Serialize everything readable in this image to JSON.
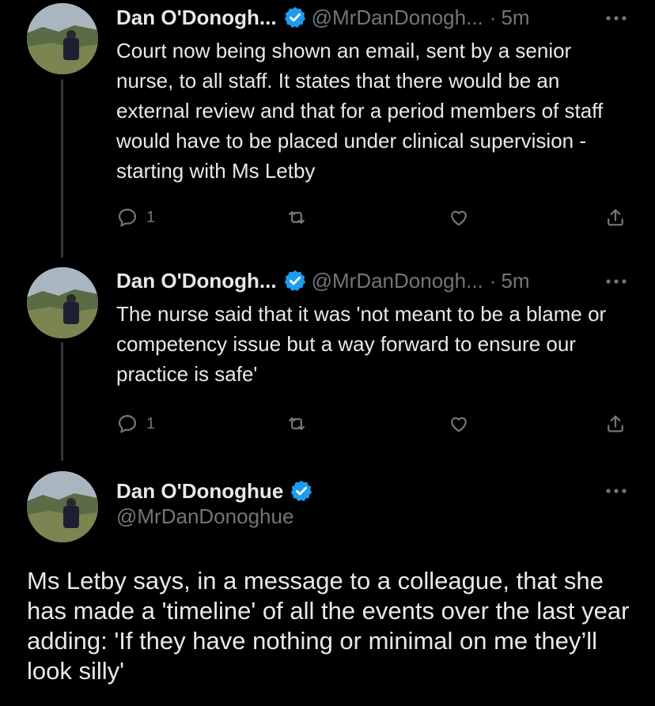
{
  "colors": {
    "background": "#000000",
    "text_primary": "#e7e9ea",
    "text_secondary": "#71767b",
    "verified_badge": "#1d9bf0",
    "thread_line": "#333639"
  },
  "tweets": [
    {
      "author_name": "Dan O'Donogh...",
      "handle": "@MrDanDonogh...",
      "separator": "·",
      "time": "5m",
      "text": "Court now being shown an email, sent by a senior nurse, to all staff. It states that there would be an external review and that for a period members of staff would have to be placed under clinical supervision - starting with Ms Letby",
      "reply_count": "1",
      "icons": [
        "reply-icon",
        "retweet-icon",
        "like-icon",
        "share-icon"
      ]
    },
    {
      "author_name": "Dan O'Donogh...",
      "handle": "@MrDanDonogh...",
      "separator": "·",
      "time": "5m",
      "text": "The nurse said that it was 'not meant to be a blame or competency issue but a way forward to ensure our practice is safe'",
      "reply_count": "1",
      "icons": [
        "reply-icon",
        "retweet-icon",
        "like-icon",
        "share-icon"
      ]
    }
  ],
  "main_tweet": {
    "author_name": "Dan O'Donoghue",
    "handle": "@MrDanDonoghue",
    "text": "Ms Letby says, in a message to a colleague, that she has made a 'timeline' of all the events over the last year adding: 'If they have nothing or minimal on me they’ll look silly'"
  }
}
